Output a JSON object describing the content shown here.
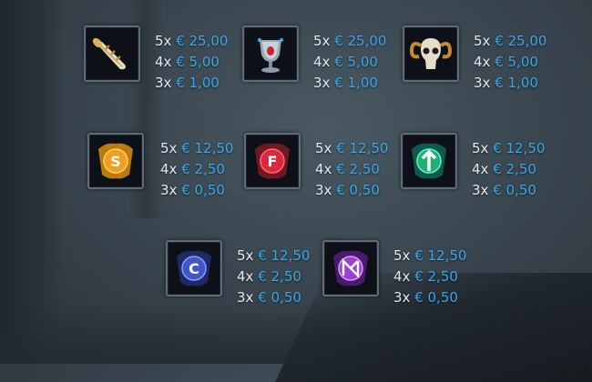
{
  "paytable": {
    "symbols": [
      {
        "name": "drinking-horn",
        "icon": "drinking-horn-icon",
        "pays": [
          {
            "count": "5x",
            "amount": "€ 25,00"
          },
          {
            "count": "4x",
            "amount": "€ 5,00"
          },
          {
            "count": "3x",
            "amount": "€ 1,00"
          }
        ]
      },
      {
        "name": "chalice",
        "icon": "chalice-icon",
        "pays": [
          {
            "count": "5x",
            "amount": "€ 25,00"
          },
          {
            "count": "4x",
            "amount": "€ 5,00"
          },
          {
            "count": "3x",
            "amount": "€ 1,00"
          }
        ]
      },
      {
        "name": "ram-skull",
        "icon": "ram-skull-icon",
        "pays": [
          {
            "count": "5x",
            "amount": "€ 25,00"
          },
          {
            "count": "4x",
            "amount": "€ 5,00"
          },
          {
            "count": "3x",
            "amount": "€ 1,00"
          }
        ]
      },
      {
        "name": "gold-rune",
        "icon": "gold-rune-icon",
        "glyph": "S",
        "color": "#f0a020",
        "pays": [
          {
            "count": "5x",
            "amount": "€ 12,50"
          },
          {
            "count": "4x",
            "amount": "€ 2,50"
          },
          {
            "count": "3x",
            "amount": "€ 0,50"
          }
        ]
      },
      {
        "name": "red-rune",
        "icon": "red-rune-icon",
        "glyph": "F",
        "color": "#d8283a",
        "pays": [
          {
            "count": "5x",
            "amount": "€ 12,50"
          },
          {
            "count": "4x",
            "amount": "€ 2,50"
          },
          {
            "count": "3x",
            "amount": "€ 0,50"
          }
        ]
      },
      {
        "name": "green-rune",
        "icon": "green-rune-icon",
        "glyph": "T",
        "color": "#1fae74",
        "pays": [
          {
            "count": "5x",
            "amount": "€ 12,50"
          },
          {
            "count": "4x",
            "amount": "€ 2,50"
          },
          {
            "count": "3x",
            "amount": "€ 0,50"
          }
        ]
      },
      {
        "name": "blue-rune",
        "icon": "blue-rune-icon",
        "glyph": "C",
        "color": "#3f55c8",
        "pays": [
          {
            "count": "5x",
            "amount": "€ 12,50"
          },
          {
            "count": "4x",
            "amount": "€ 2,50"
          },
          {
            "count": "3x",
            "amount": "€ 0,50"
          }
        ]
      },
      {
        "name": "purple-rune",
        "icon": "purple-rune-icon",
        "glyph": "M",
        "color": "#9c3fd0",
        "pays": [
          {
            "count": "5x",
            "amount": "€ 12,50"
          },
          {
            "count": "4x",
            "amount": "€ 2,50"
          },
          {
            "count": "3x",
            "amount": "€ 0,50"
          }
        ]
      }
    ]
  },
  "colors": {
    "amount": "#3aa7e8",
    "multiplier": "#e6e9ec",
    "background": "#3a4650"
  }
}
